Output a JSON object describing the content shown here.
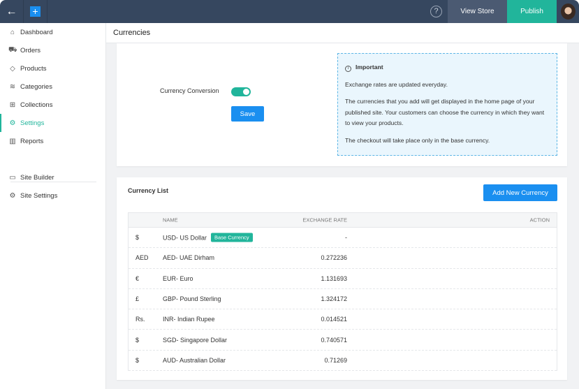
{
  "topbar": {
    "view_store": "View Store",
    "publish": "Publish",
    "help": "?"
  },
  "sidebar": {
    "items": [
      {
        "label": "Dashboard",
        "icon": "home-icon"
      },
      {
        "label": "Orders",
        "icon": "cart-icon"
      },
      {
        "label": "Products",
        "icon": "tag-icon"
      },
      {
        "label": "Categories",
        "icon": "layers-icon"
      },
      {
        "label": "Collections",
        "icon": "grid-plus-icon"
      },
      {
        "label": "Settings",
        "icon": "gear-icon",
        "active": true
      },
      {
        "label": "Reports",
        "icon": "bar-chart-icon"
      }
    ],
    "secondary": [
      {
        "label": "Site Builder",
        "icon": "site-builder-icon"
      },
      {
        "label": "Site Settings",
        "icon": "gear-icon"
      }
    ]
  },
  "page": {
    "title": "Currencies"
  },
  "conversion": {
    "label": "Currency Conversion",
    "enabled": true,
    "save": "Save"
  },
  "info": {
    "title": "Important",
    "lines": [
      "Exchange rates are updated everyday.",
      "The currencies that you add will get displayed in the home page of your published site. Your customers can choose the currency in which they want to view your products.",
      "The checkout will take place only in the base currency."
    ]
  },
  "list": {
    "title": "Currency List",
    "add": "Add New Currency",
    "headers": {
      "name": "NAME",
      "rate": "EXCHANGE RATE",
      "action": "ACTION"
    },
    "base_badge": "Base Currency",
    "rows": [
      {
        "symbol": "$",
        "name": "USD- US Dollar",
        "rate": "-"
      },
      {
        "symbol": "AED",
        "name": "AED- UAE Dirham",
        "rate": "0.272236"
      },
      {
        "symbol": "€",
        "name": "EUR- Euro",
        "rate": "1.131693"
      },
      {
        "symbol": "£",
        "name": "GBP- Pound Sterling",
        "rate": "1.324172"
      },
      {
        "symbol": "Rs.",
        "name": "INR- Indian Rupee",
        "rate": "0.014521"
      },
      {
        "symbol": "$",
        "name": "SGD- Singapore Dollar",
        "rate": "0.740571"
      },
      {
        "symbol": "$",
        "name": "AUD- Australian Dollar",
        "rate": "0.71269"
      }
    ]
  }
}
